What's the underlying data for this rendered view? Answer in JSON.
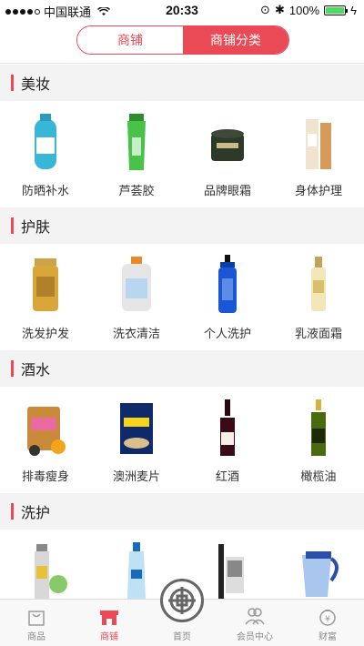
{
  "status_bar": {
    "carrier": "中国联通",
    "time": "20:33",
    "battery": "100%",
    "battery_level": 1.0
  },
  "segmented": {
    "options": [
      "商铺",
      "商铺分类"
    ],
    "selected": "商铺分类"
  },
  "sections": [
    {
      "title": "美妆",
      "items": [
        {
          "label": "防晒补水",
          "icon": "sunscreen-bottle"
        },
        {
          "label": "芦荟胶",
          "icon": "aloe-gel-tube"
        },
        {
          "label": "品牌眼霜",
          "icon": "eye-cream-jar"
        },
        {
          "label": "身体护理",
          "icon": "body-care-bottles"
        }
      ]
    },
    {
      "title": "护肤",
      "items": [
        {
          "label": "洗发护发",
          "icon": "shampoo-bottle"
        },
        {
          "label": "洗衣清洁",
          "icon": "detergent-bottle"
        },
        {
          "label": "个人洗护",
          "icon": "pump-bottle"
        },
        {
          "label": "乳液面霜",
          "icon": "lotion-bottle"
        }
      ]
    },
    {
      "title": "酒水",
      "items": [
        {
          "label": "排毒瘦身",
          "icon": "detox-pouch"
        },
        {
          "label": "澳洲麦片",
          "icon": "muesli-bag"
        },
        {
          "label": "红酒",
          "icon": "wine-bottle"
        },
        {
          "label": "橄榄油",
          "icon": "olive-oil-bottle"
        }
      ]
    },
    {
      "title": "洗护",
      "items": [
        {
          "label": "",
          "icon": "spray-can"
        },
        {
          "label": "",
          "icon": "water-bottle"
        },
        {
          "label": "",
          "icon": "electric-toothbrush"
        },
        {
          "label": "",
          "icon": "water-filter-pitcher"
        }
      ]
    }
  ],
  "tabbar": [
    {
      "label": "商品",
      "icon": "bag-icon"
    },
    {
      "label": "商铺",
      "icon": "shop-icon",
      "active": true
    },
    {
      "label": "首页",
      "icon": "home-icon"
    },
    {
      "label": "会员中心",
      "icon": "members-icon"
    },
    {
      "label": "财富",
      "icon": "money-bag-icon"
    }
  ],
  "colors": {
    "accent": "#e94a55",
    "background": "#f3f3f3"
  }
}
